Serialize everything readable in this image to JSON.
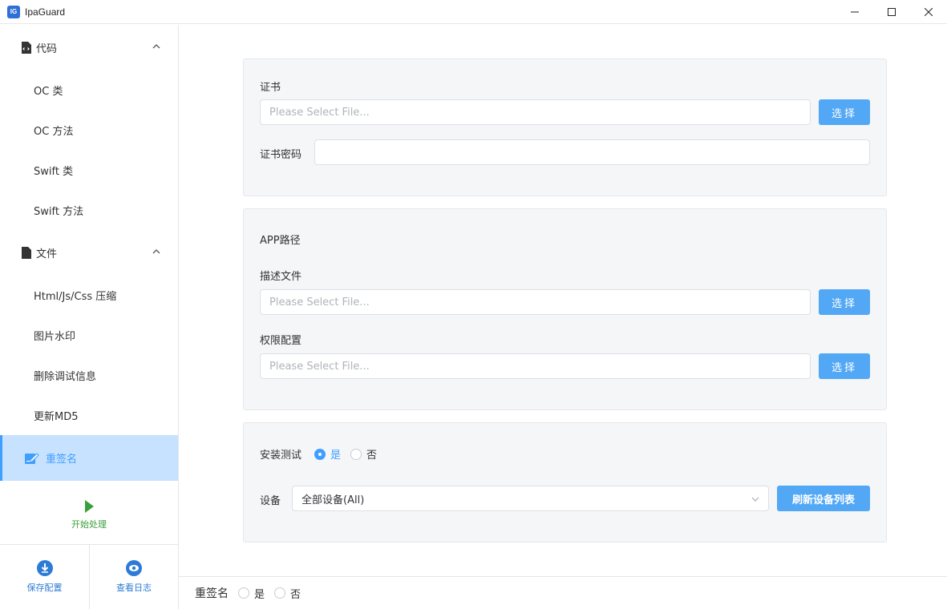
{
  "window": {
    "title": "IpaGuard",
    "logo_text": "IG"
  },
  "sidebar": {
    "groups": [
      {
        "label": "代码",
        "items": [
          "OC 类",
          "OC 方法",
          "Swift 类",
          "Swift 方法"
        ]
      },
      {
        "label": "文件",
        "items": [
          "Html/Js/Css 压缩",
          "图片水印",
          "删除调试信息",
          "更新MD5"
        ]
      }
    ],
    "active_item": "重签名",
    "start_label": "开始处理",
    "save_label": "保存配置",
    "log_label": "查看日志"
  },
  "cert_panel": {
    "cert_label": "证书",
    "cert_placeholder": "Please Select File...",
    "cert_button": "选择",
    "password_label": "证书密码",
    "password_value": ""
  },
  "app_panel": {
    "title": "APP路径",
    "profile_label": "描述文件",
    "profile_placeholder": "Please Select File...",
    "profile_button": "选择",
    "entitlement_label": "权限配置",
    "entitlement_placeholder": "Please Select File...",
    "entitlement_button": "选择"
  },
  "install_panel": {
    "install_label": "安装测试",
    "yes_label": "是",
    "no_label": "否",
    "install_selected": "yes",
    "device_label": "设备",
    "device_value": "全部设备(All)",
    "refresh_button": "刷新设备列表"
  },
  "footer": {
    "label": "重签名",
    "yes_label": "是",
    "no_label": "否"
  },
  "colors": {
    "accent": "#409eff",
    "button": "#52a8f5",
    "active_bg": "#c6e2ff",
    "start_green": "#3a9f3a",
    "panel_bg": "#f5f6f8"
  }
}
